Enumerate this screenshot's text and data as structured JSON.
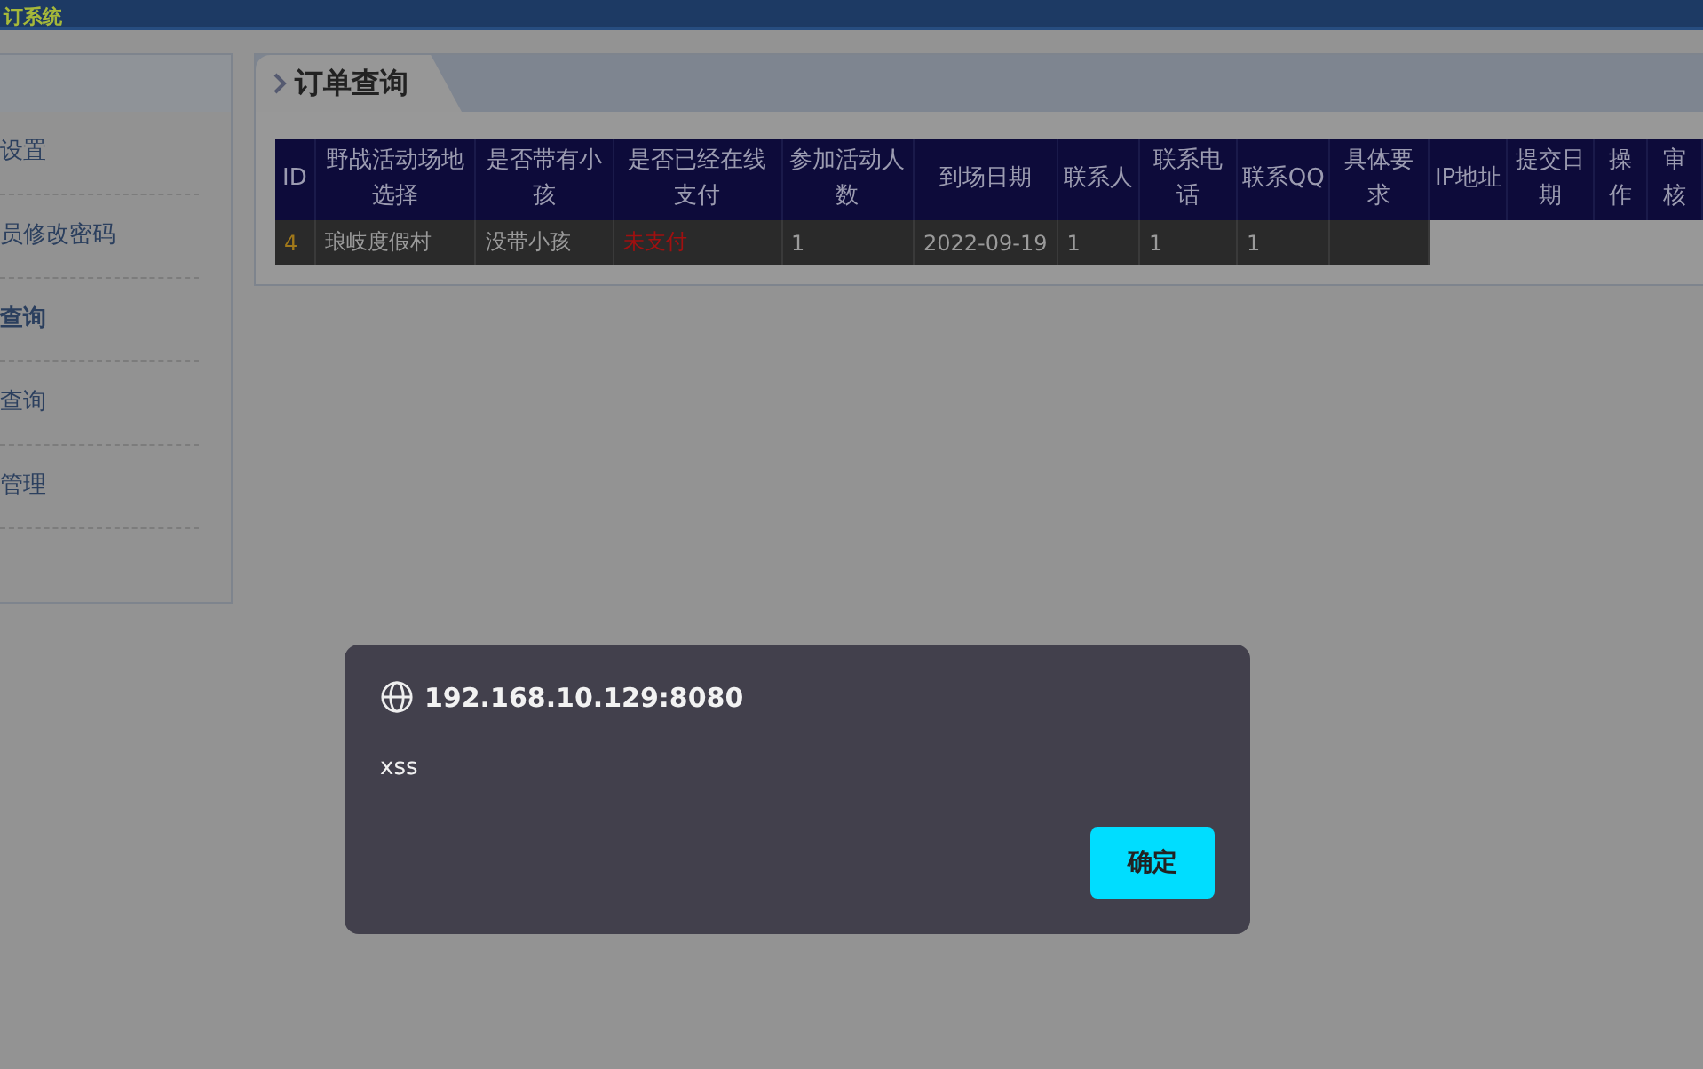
{
  "header": {
    "title": "订系统"
  },
  "sidebar": {
    "items": [
      {
        "label": "设置",
        "selected": false
      },
      {
        "label": "员修改密码",
        "selected": false
      },
      {
        "label": "查询",
        "selected": true
      },
      {
        "label": "查询",
        "selected": false
      },
      {
        "label": "管理",
        "selected": false
      }
    ]
  },
  "panel": {
    "title": "订单查询"
  },
  "table": {
    "columns": [
      "ID",
      "野战活动场地选择",
      "是否带有小孩",
      "是否已经在线支付",
      "参加活动人数",
      "到场日期",
      "联系人",
      "联系电话",
      "联系QQ",
      "具体要求",
      "IP地址",
      "提交日期",
      "操作",
      "审核"
    ],
    "rows": [
      {
        "cells": [
          {
            "kind": "id",
            "text": "4"
          },
          {
            "kind": "plain",
            "text": "琅岐度假村"
          },
          {
            "kind": "plain",
            "text": "没带小孩"
          },
          {
            "kind": "alert",
            "text": "未支付"
          },
          {
            "kind": "plain",
            "text": "1"
          },
          {
            "kind": "plain",
            "text": "2022-09-19"
          },
          {
            "kind": "plain",
            "text": "1"
          },
          {
            "kind": "plain",
            "text": "1"
          },
          {
            "kind": "plain",
            "text": "1"
          },
          {
            "kind": "plain"
          }
        ]
      }
    ]
  },
  "dialog": {
    "origin": "192.168.10.129:8080",
    "message": "xss",
    "button": "确定"
  }
}
